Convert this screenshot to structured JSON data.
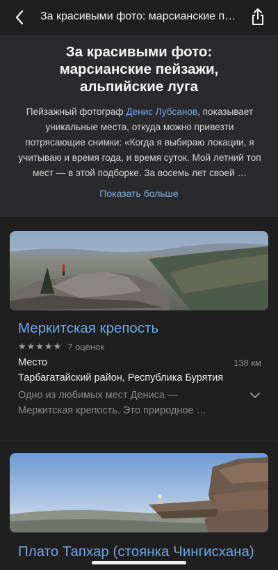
{
  "topbar": {
    "title": "За красивыми фото: марсианские пейзажи, альпийские луга"
  },
  "collection": {
    "title": "За красивыми фото: марсианские пейзажи, альпийские луга",
    "description_prefix": "Пейзажный фотограф ",
    "author": "Денис Лубсанов",
    "description_suffix": ", показывает уникальные места, откуда можно привезти потрясающие снимки: «Когда я выбираю локации, я учитываю и время года, и время суток. Мой летний топ мест — в этой подборке. За восемь лет своей …",
    "show_more": "Показать больше"
  },
  "places": [
    {
      "title": "Меркитская крепость",
      "stars": "★★★★★",
      "rating_count": "7 оценок",
      "type": "Место",
      "distance": "138 км",
      "address": "Тарбагатайский район, Республика Бурятия",
      "snippet": "Одно из любимых мест Дениса — Меркитская крепость. Это природное …"
    },
    {
      "title": "Плато Тапхар (стоянка Чингисхана)"
    }
  ],
  "colors": {
    "background": "#1f1f1f",
    "header_block": "#2a2a2c",
    "accent_link": "#6ea5e6"
  },
  "icons": {
    "back": "chevron-left-icon",
    "share": "share-icon",
    "expand": "chevron-down-icon"
  }
}
